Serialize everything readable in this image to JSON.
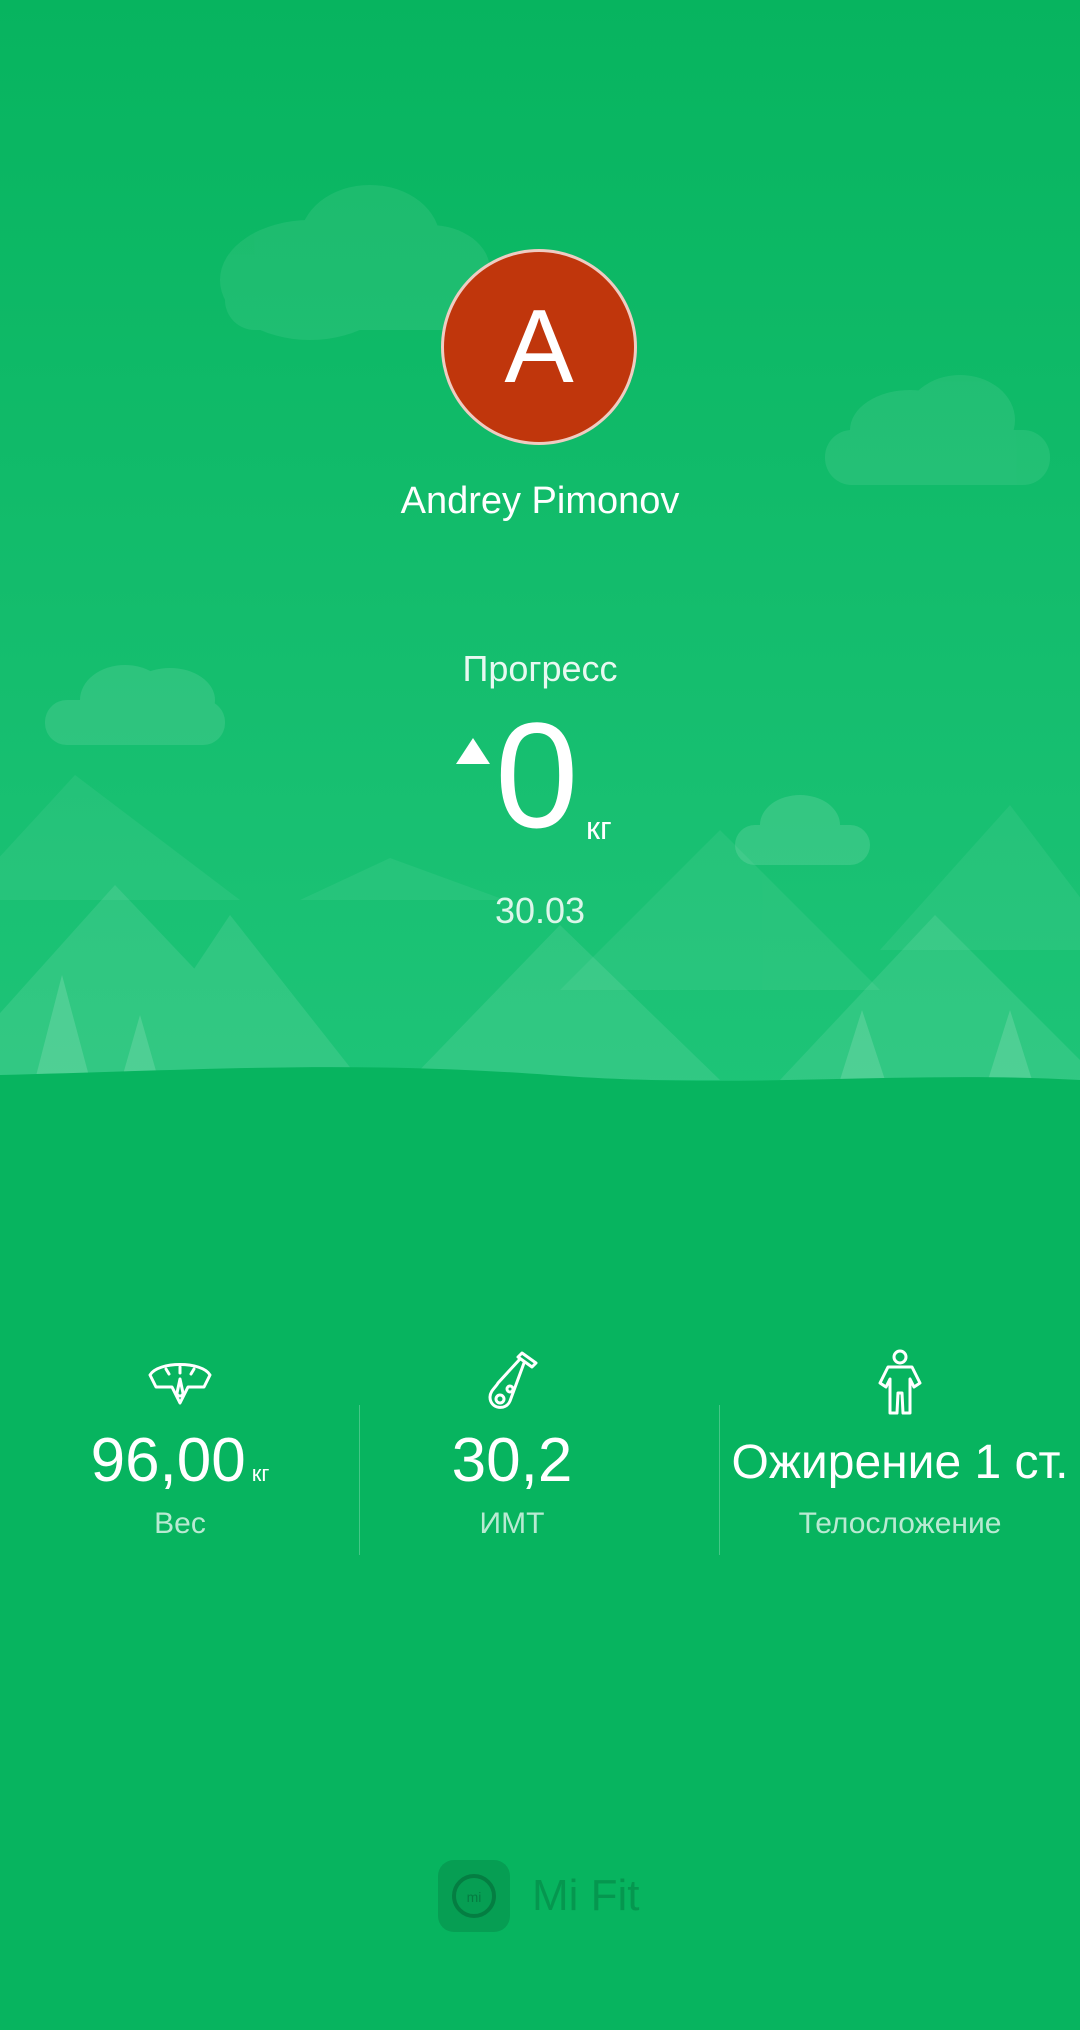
{
  "profile": {
    "avatar_letter": "A",
    "name": "Andrey Pimonov",
    "avatar_color": "#c0360c"
  },
  "progress": {
    "label": "Прогресс",
    "value": "0",
    "unit": "кг",
    "direction_icon": "arrow-up-icon",
    "date": "30.03"
  },
  "stats": [
    {
      "icon": "scale-icon",
      "value": "96,00",
      "unit": "кг",
      "label": "Вес"
    },
    {
      "icon": "flask-icon",
      "value": "30,2",
      "unit": "",
      "label": "ИМТ"
    },
    {
      "icon": "body-icon",
      "value": "Ожирение 1 ст.",
      "unit": "",
      "label": "Телосложение"
    }
  ],
  "brand": {
    "name": "Mi Fit",
    "logo_icon": "mi-logo-icon"
  },
  "colors": {
    "background": "#07b45f",
    "accent": "#c0360c"
  }
}
